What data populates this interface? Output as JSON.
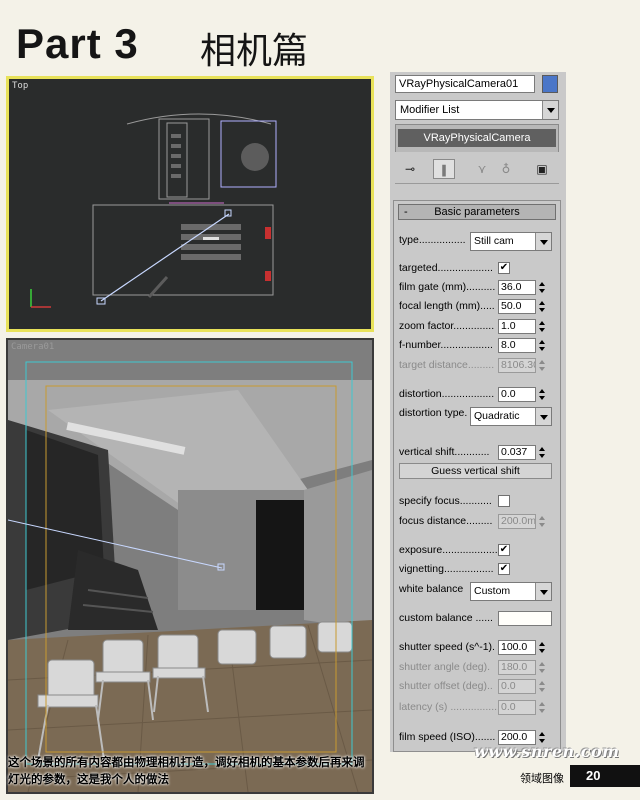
{
  "heading": {
    "part": "Part 3",
    "title": "相机篇"
  },
  "viewports": {
    "top_label": "Top",
    "camera_label": "Camera01"
  },
  "caption": "这个场景的所有内容都由物理相机打造，调好相机的基本参数后再来调灯光的参数，这是我个人的做法",
  "panel": {
    "object_name": "VRayPhysicalCamera01",
    "modifier_list": "Modifier List",
    "stack_item": "VRayPhysicalCamera",
    "rollout_title": "Basic parameters",
    "rollout_minus": "-",
    "type_label": "type................",
    "type_value": "Still cam",
    "targeted_label": "targeted...................",
    "film_gate_label": "film gate (mm)..........",
    "film_gate_value": "36.0",
    "focal_length_label": "focal length (mm).....",
    "focal_length_value": "50.0",
    "zoom_factor_label": "zoom factor..............",
    "zoom_factor_value": "1.0",
    "f_number_label": "f-number..................",
    "f_number_value": "8.0",
    "target_distance_label": "target distance.........",
    "target_distance_value": "8106.30",
    "distortion_label": "distortion..................",
    "distortion_value": "0.0",
    "distortion_type_label": "distortion type.",
    "distortion_type_value": "Quadratic",
    "vertical_shift_label": "vertical shift............",
    "vertical_shift_value": "0.037",
    "guess_vertical_shift": "Guess vertical shift",
    "specify_focus_label": "specify focus...........",
    "focus_distance_label": "focus distance.........",
    "focus_distance_value": "200.0m",
    "exposure_label": "exposure...................",
    "vignetting_label": "vignetting.................",
    "white_balance_label": "white balance",
    "white_balance_value": "Custom",
    "custom_balance_label": "custom balance ......",
    "shutter_speed_label": "shutter speed (s^-1).",
    "shutter_speed_value": "100.0",
    "shutter_angle_label": "shutter angle (deg).",
    "shutter_angle_value": "180.0",
    "shutter_offset_label": "shutter offset (deg)..",
    "shutter_offset_value": "0.0",
    "latency_label": "latency (s) .................",
    "latency_value": "0.0",
    "film_speed_label": "film speed (ISO).......",
    "film_speed_value": "200.0",
    "check_mark": "✔"
  },
  "footer": {
    "watermark": "www.snren.com",
    "section": "领域图像",
    "page": "20"
  },
  "colors": {
    "viewport_active_border": "#e8e25a",
    "viewport_bg": "#2a2c2c",
    "camera_swatch": "#4a76c8",
    "panel_bg": "#c9c9c9"
  },
  "icons": [
    "pin-icon",
    "modifier-stack-icon",
    "make-unique-icon",
    "remove-modifier-icon",
    "configure-sets-icon"
  ]
}
